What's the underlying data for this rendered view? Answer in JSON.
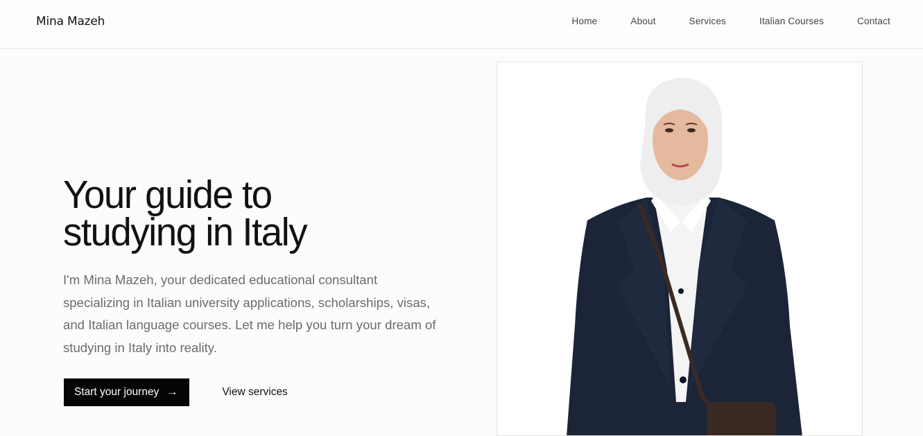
{
  "header": {
    "brand": "Mina Mazeh",
    "nav": [
      "Home",
      "About",
      "Services",
      "Italian Courses",
      "Contact"
    ]
  },
  "hero": {
    "headline_line1": "Your guide to",
    "headline_line2": "studying in Italy",
    "intro": "I'm Mina Mazeh, your dedicated educational consultant specializing in Italian university applications, scholarships, visas, and Italian language courses. Let me help you turn your dream of studying in Italy into reality.",
    "primary_cta": "Start your journey",
    "secondary_cta": "View services"
  },
  "icons": {
    "arrow": "arrow-right-icon"
  },
  "colors": {
    "accent": "#050505",
    "background": "#fdfbfc",
    "jacket": "#1c2437"
  }
}
